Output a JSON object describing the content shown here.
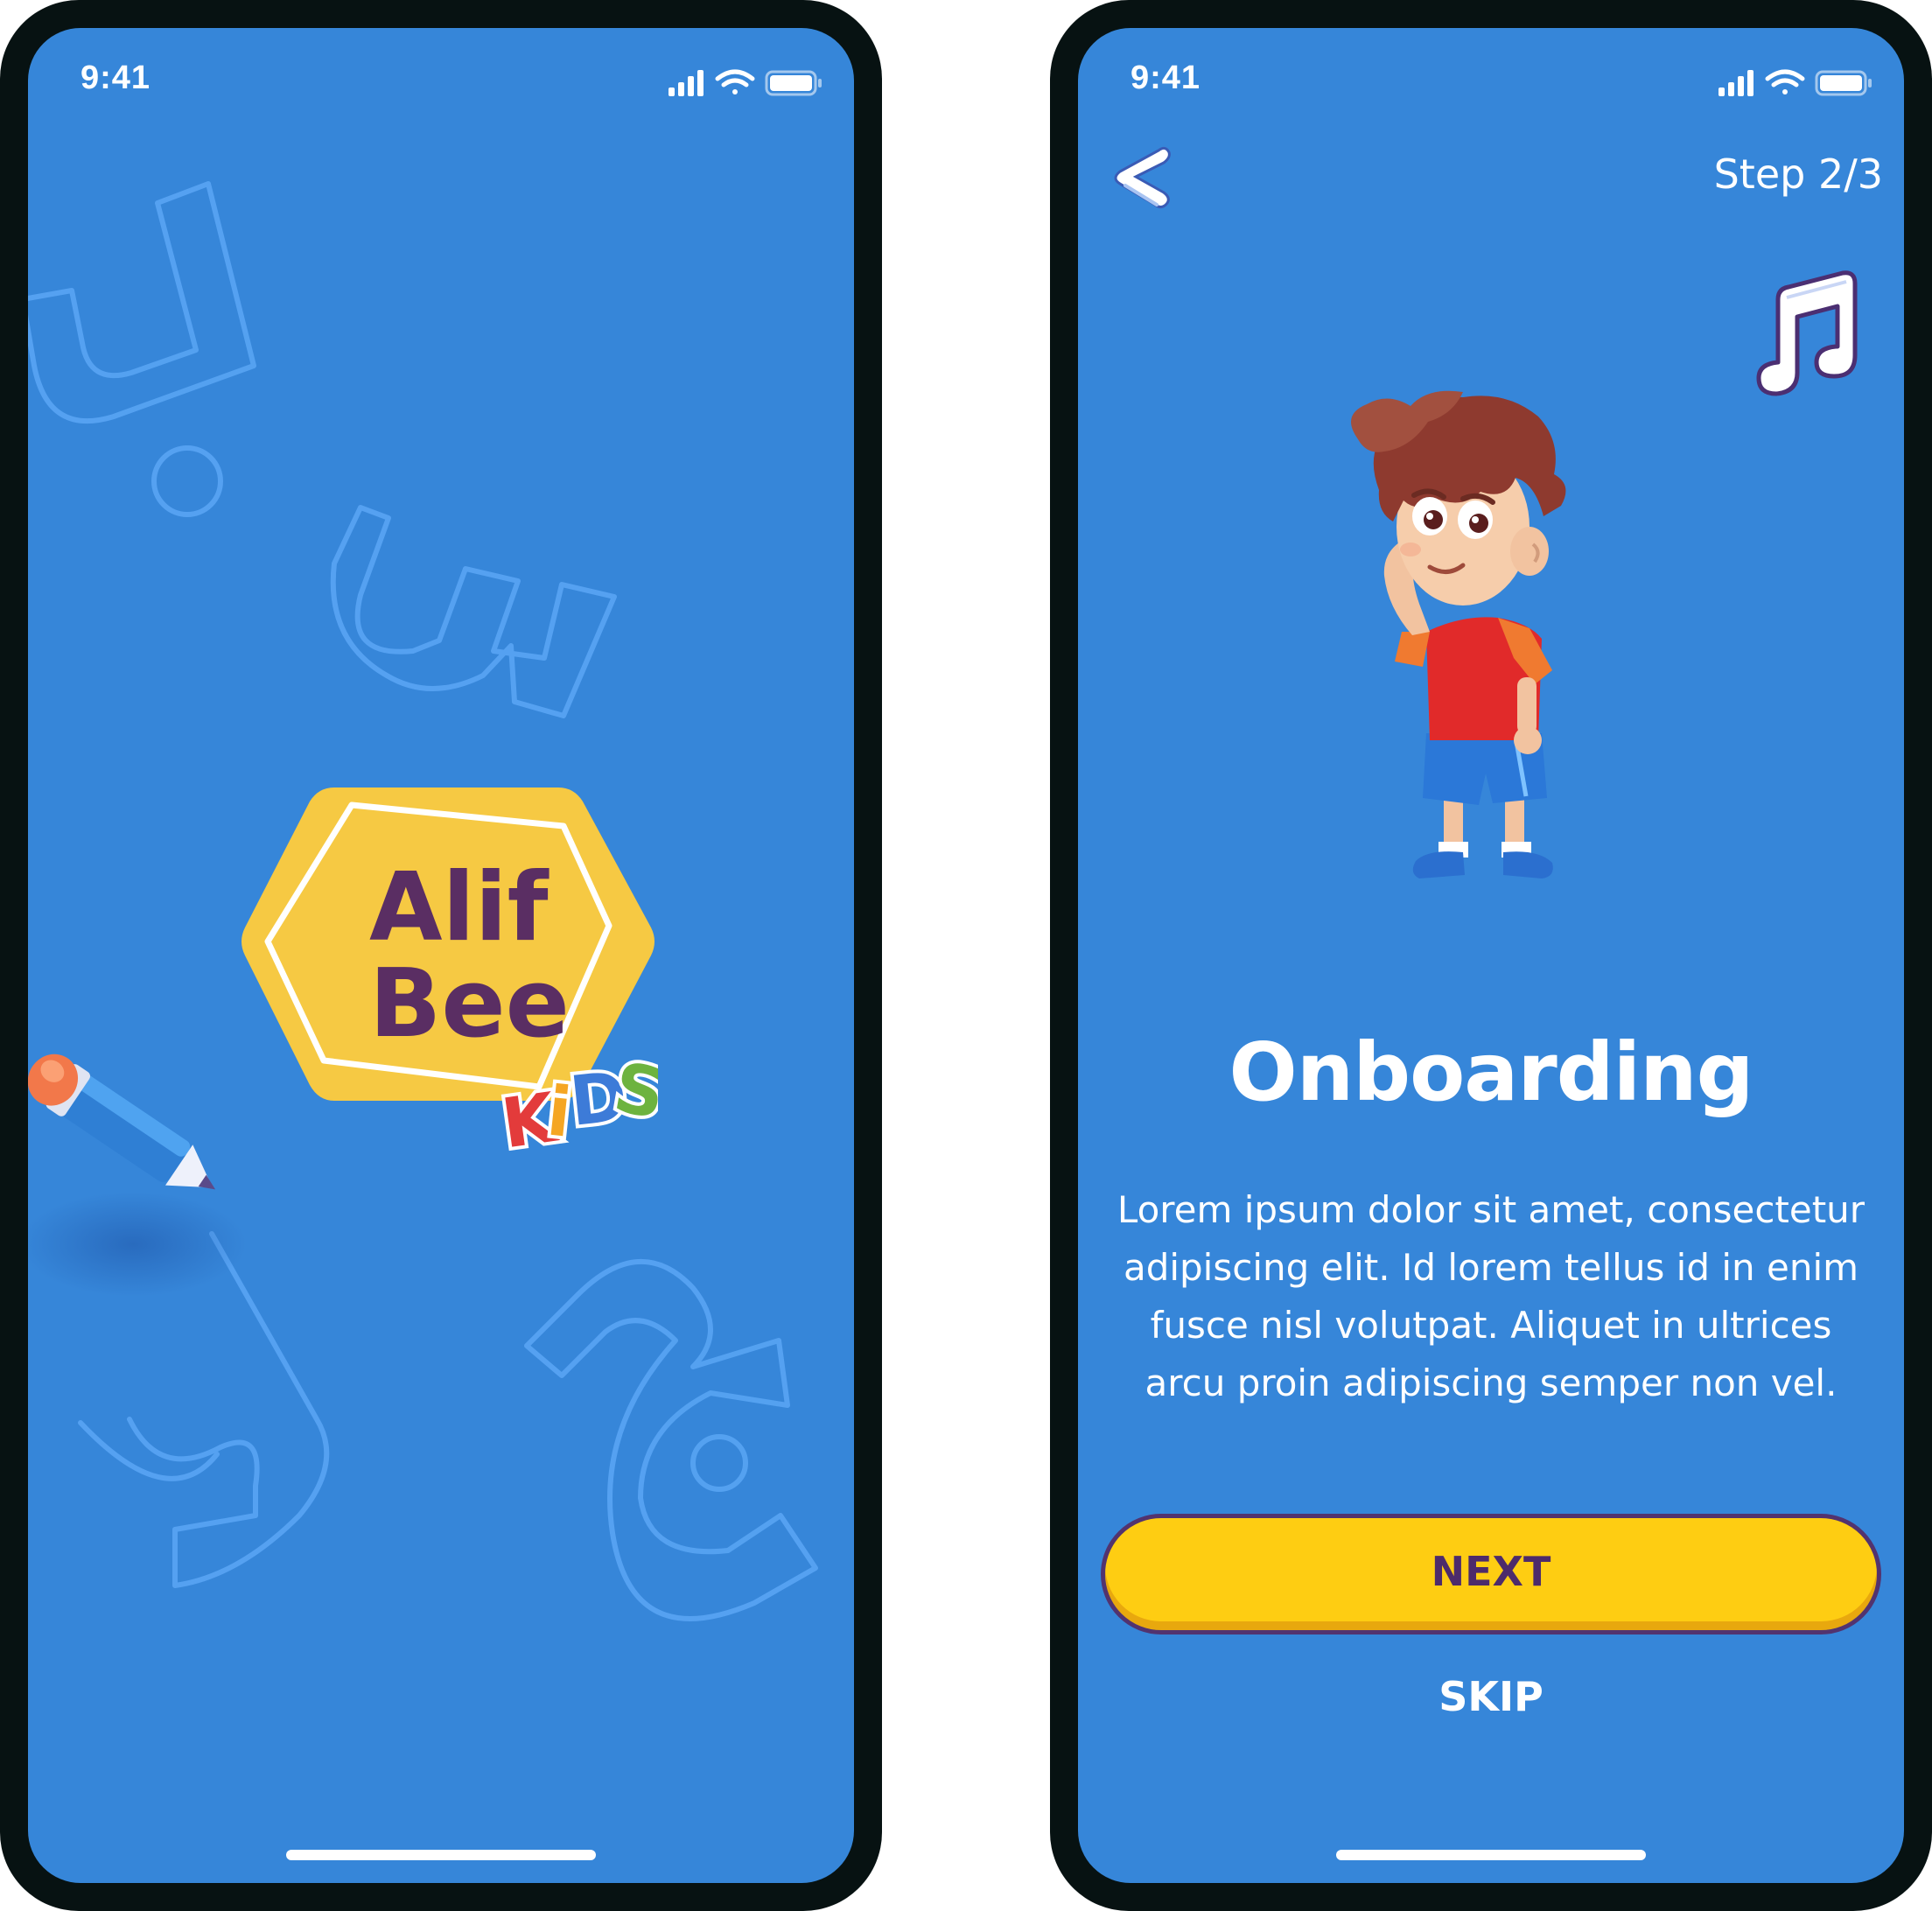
{
  "splash_screen": {
    "status_bar": {
      "time": "9:41",
      "icons": [
        "signal-icon",
        "wifi-icon",
        "battery-icon"
      ]
    },
    "logo": {
      "line1": "Alif",
      "line2": "Bee",
      "badge": "KiDS"
    },
    "decorations": [
      "arabic-letter-ba",
      "arabic-letter-seen",
      "arabic-letter-ra",
      "arabic-letter-jeem",
      "pencil-icon"
    ]
  },
  "onboarding_screen": {
    "status_bar": {
      "time": "9:41",
      "icons": [
        "signal-icon",
        "wifi-icon",
        "battery-icon"
      ]
    },
    "header": {
      "back_icon": "chevron-left-icon",
      "step": "Step 2/3",
      "music_icon": "music-note-icon"
    },
    "title": "Onboarding",
    "body": "Lorem ipsum dolor sit amet, consectetur adipiscing elit. Id lorem tellus id in enim fusce nisl volutpat. Aliquet in ultrices arcu proin adipiscing semper non vel.",
    "next_label": "NEXT",
    "skip_label": "SKIP"
  },
  "colors": {
    "screen_bg": "#3686d9",
    "phone_frame": "#071212",
    "button_yellow": "#fecd12",
    "button_border": "#52336f",
    "logo_yellow": "#f6c943",
    "logo_text": "#5a2e63"
  }
}
